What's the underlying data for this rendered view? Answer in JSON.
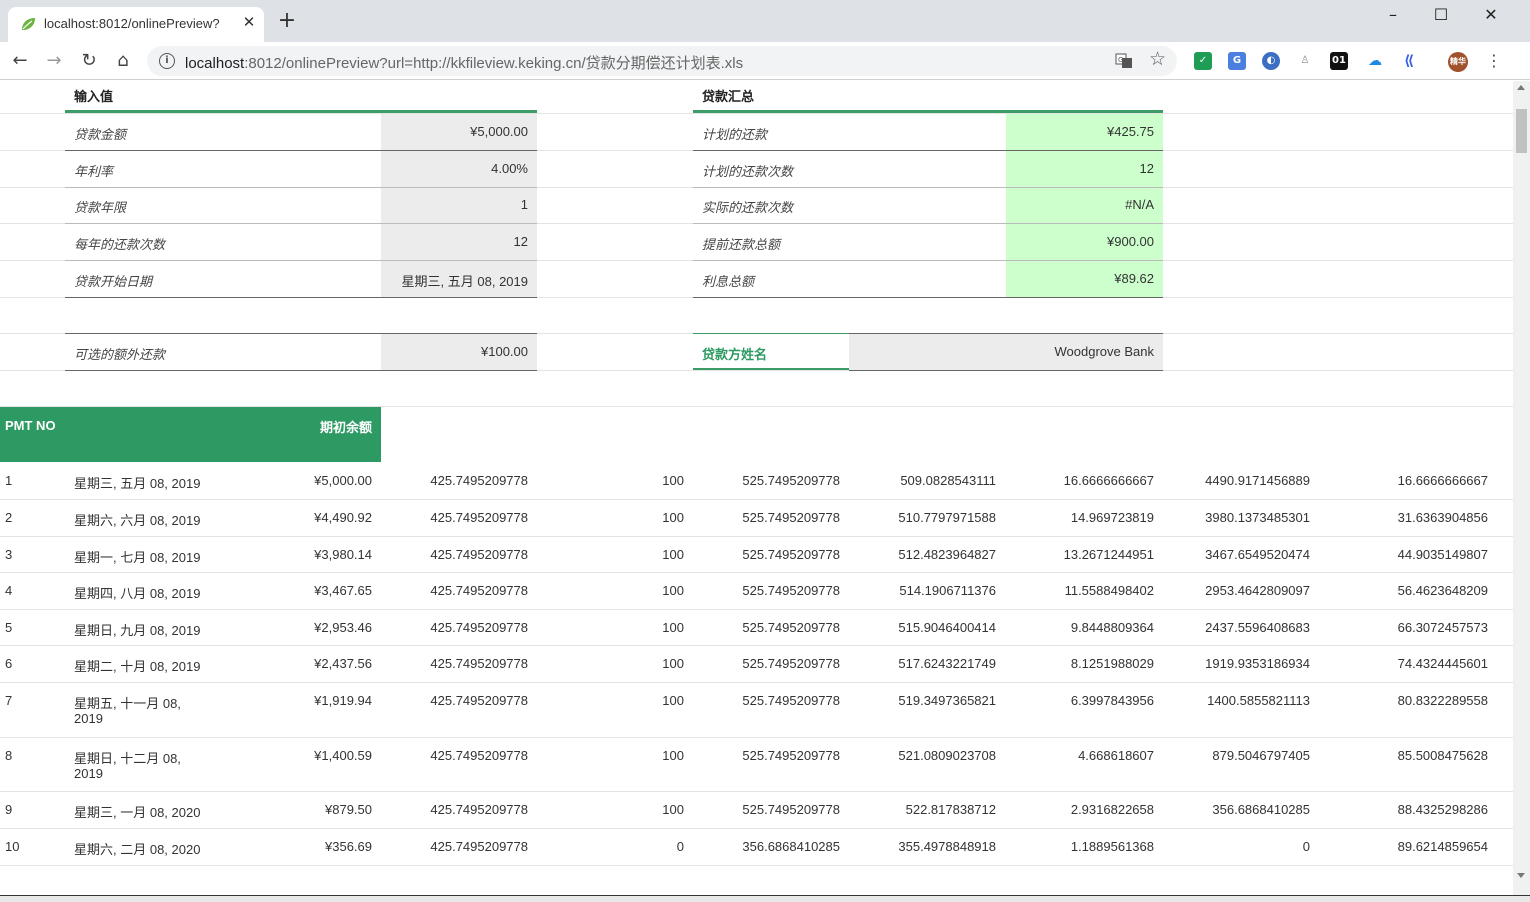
{
  "browser": {
    "tab_title": "localhost:8012/onlinePreview?",
    "url_host": "localhost",
    "url_rest": ":8012/onlinePreview?url=http://kkfileview.keking.cn/贷款分期偿还计划表.xls",
    "ext_01_label": "01",
    "avatar_label": "精华"
  },
  "inputs": {
    "title": "输入值",
    "rows": [
      {
        "label": "贷款金额",
        "value": "¥5,000.00"
      },
      {
        "label": "年利率",
        "value": "4.00%"
      },
      {
        "label": "贷款年限",
        "value": "1"
      },
      {
        "label": "每年的还款次数",
        "value": "12"
      },
      {
        "label": "贷款开始日期",
        "value": "星期三, 五月 08, 2019"
      }
    ],
    "extra_label": "可选的额外还款",
    "extra_value": "¥100.00"
  },
  "summary": {
    "title": "贷款汇总",
    "rows": [
      {
        "label": "计划的还款",
        "value": "¥425.75"
      },
      {
        "label": "计划的还款次数",
        "value": "12"
      },
      {
        "label": "实际的还款次数",
        "value": "#N/A"
      },
      {
        "label": "提前还款总额",
        "value": "¥900.00"
      },
      {
        "label": "利息总额",
        "value": "¥89.62"
      }
    ],
    "lender_label": "贷款方姓名",
    "lender_value": "Woodgrove Bank"
  },
  "schedule": {
    "headers": [
      "PMT NO",
      "",
      "期初余额",
      "",
      "",
      "",
      "",
      "",
      "",
      ""
    ],
    "rows": [
      [
        "1",
        "星期三, 五月 08, 2019",
        "¥5,000.00",
        "425.7495209778",
        "100",
        "525.7495209778",
        "509.0828543111",
        "16.6666666667",
        "4490.9171456889",
        "16.6666666667"
      ],
      [
        "2",
        "星期六, 六月 08, 2019",
        "¥4,490.92",
        "425.7495209778",
        "100",
        "525.7495209778",
        "510.7797971588",
        "14.969723819",
        "3980.1373485301",
        "31.6363904856"
      ],
      [
        "3",
        "星期一, 七月 08, 2019",
        "¥3,980.14",
        "425.7495209778",
        "100",
        "525.7495209778",
        "512.4823964827",
        "13.2671244951",
        "3467.6549520474",
        "44.9035149807"
      ],
      [
        "4",
        "星期四, 八月 08, 2019",
        "¥3,467.65",
        "425.7495209778",
        "100",
        "525.7495209778",
        "514.1906711376",
        "11.5588498402",
        "2953.4642809097",
        "56.4623648209"
      ],
      [
        "5",
        "星期日, 九月 08, 2019",
        "¥2,953.46",
        "425.7495209778",
        "100",
        "525.7495209778",
        "515.9046400414",
        "9.8448809364",
        "2437.5596408683",
        "66.3072457573"
      ],
      [
        "6",
        "星期二, 十月 08, 2019",
        "¥2,437.56",
        "425.7495209778",
        "100",
        "525.7495209778",
        "517.6243221749",
        "8.1251988029",
        "1919.9353186934",
        "74.4324445601"
      ],
      [
        "7",
        "星期五, 十一月 08,",
        "¥1,919.94",
        "425.7495209778",
        "100",
        "525.7495209778",
        "519.3497365821",
        "6.3997843956",
        "1400.5855821113",
        "80.8322289558"
      ],
      [
        "8",
        "星期日, 十二月 08,",
        "¥1,400.59",
        "425.7495209778",
        "100",
        "525.7495209778",
        "521.0809023708",
        "4.668618607",
        "879.5046797405",
        "85.5008475628"
      ],
      [
        "9",
        "星期三, 一月 08, 2020",
        "¥879.50",
        "425.7495209778",
        "100",
        "525.7495209778",
        "522.817838712",
        "2.9316822658",
        "356.6868410285",
        "88.4325298286"
      ],
      [
        "10",
        "星期六, 二月 08, 2020",
        "¥356.69",
        "425.7495209778",
        "0",
        "356.6868410285",
        "355.4978848918",
        "1.1889561368",
        "0",
        "89.6214859654"
      ]
    ],
    "wrap_year_7": "2019",
    "wrap_year_8": "2019"
  }
}
